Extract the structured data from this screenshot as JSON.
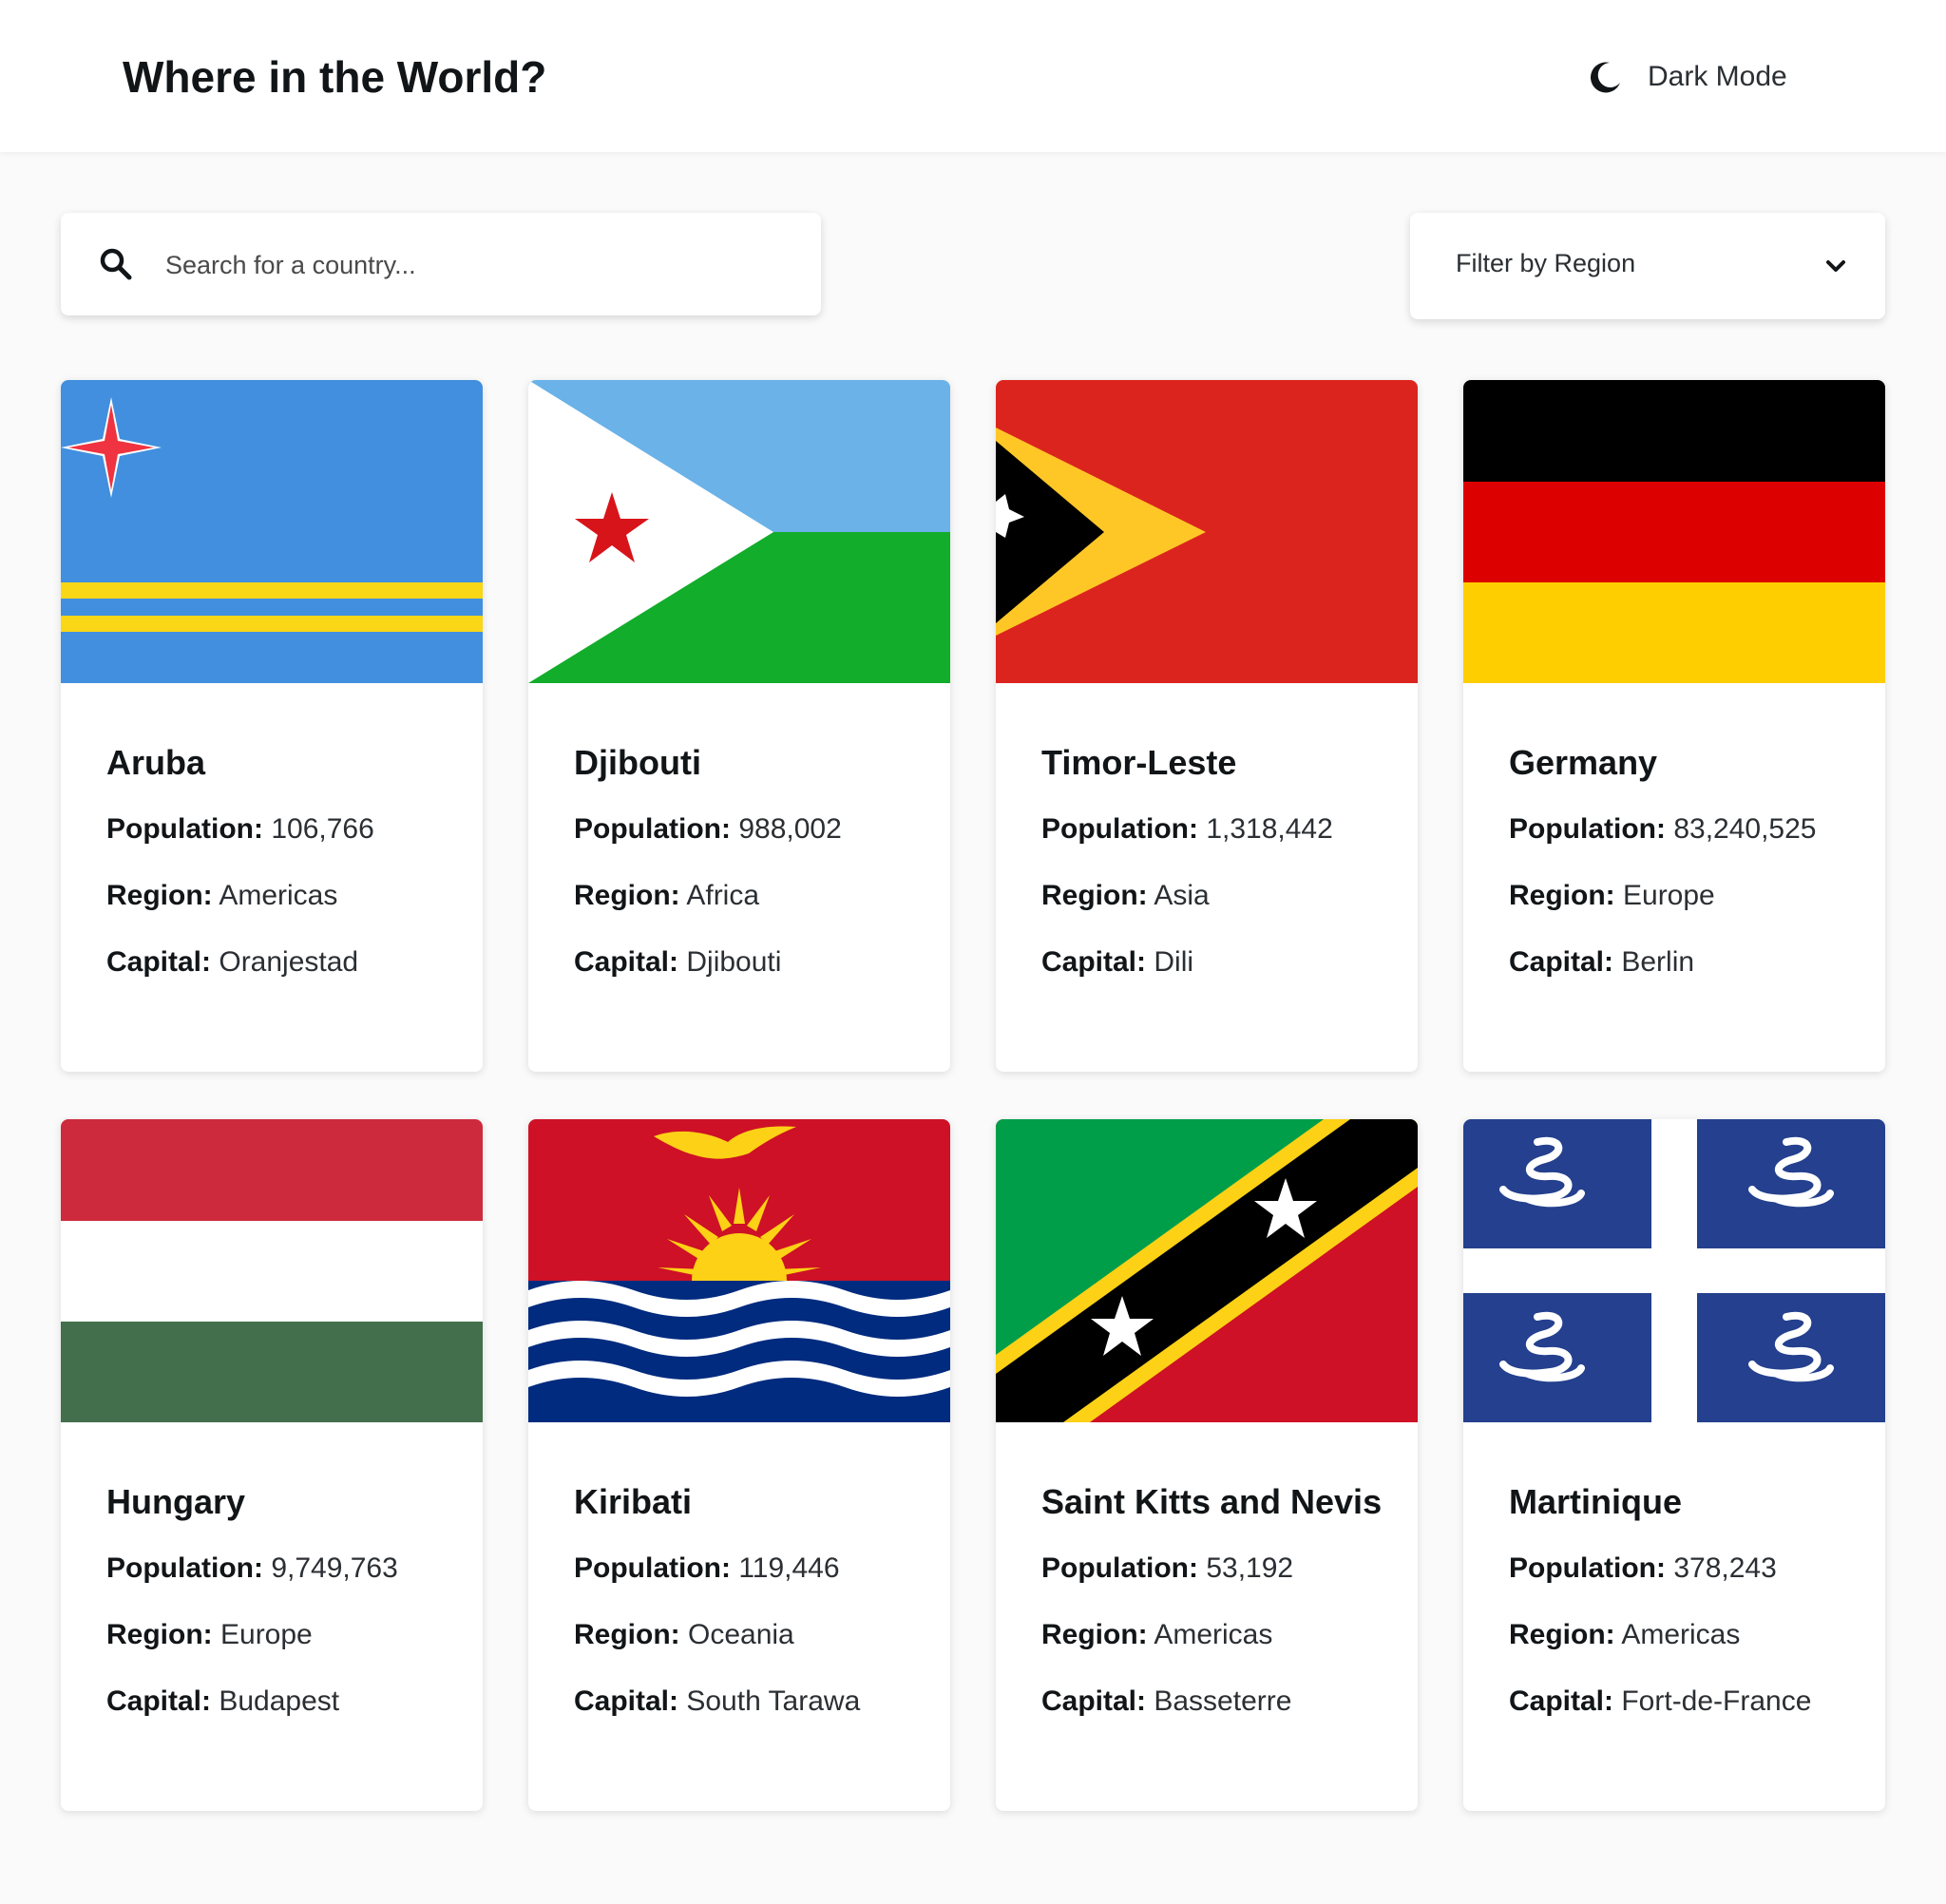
{
  "header": {
    "title": "Where in the World?",
    "theme_toggle": {
      "label": "Dark Mode",
      "icon": "moon-icon"
    }
  },
  "search": {
    "placeholder": "Search for a country...",
    "value": "",
    "icon": "search-icon"
  },
  "filter": {
    "label": "Filter by Region",
    "icon": "chevron-down-icon"
  },
  "labels": {
    "population": "Population:",
    "region": "Region:",
    "capital": "Capital:"
  },
  "countries": [
    {
      "name": "Aruba",
      "population": "106,766",
      "region": "Americas",
      "capital": "Oranjestad",
      "flag": "aruba-flag"
    },
    {
      "name": "Djibouti",
      "population": "988,002",
      "region": "Africa",
      "capital": "Djibouti",
      "flag": "djibouti-flag"
    },
    {
      "name": "Timor-Leste",
      "population": "1,318,442",
      "region": "Asia",
      "capital": "Dili",
      "flag": "timor-leste-flag"
    },
    {
      "name": "Germany",
      "population": "83,240,525",
      "region": "Europe",
      "capital": "Berlin",
      "flag": "germany-flag"
    },
    {
      "name": "Hungary",
      "population": "9,749,763",
      "region": "Europe",
      "capital": "Budapest",
      "flag": "hungary-flag"
    },
    {
      "name": "Kiribati",
      "population": "119,446",
      "region": "Oceania",
      "capital": "South Tarawa",
      "flag": "kiribati-flag"
    },
    {
      "name": "Saint Kitts and Nevis",
      "population": "53,192",
      "region": "Americas",
      "capital": "Basseterre",
      "flag": "saint-kitts-and-nevis-flag"
    },
    {
      "name": "Martinique",
      "population": "378,243",
      "region": "Americas",
      "capital": "Fort-de-France",
      "flag": "martinique-flag"
    }
  ],
  "colors": {
    "background": "#fafafa",
    "surface": "#ffffff",
    "text": "#111517"
  }
}
